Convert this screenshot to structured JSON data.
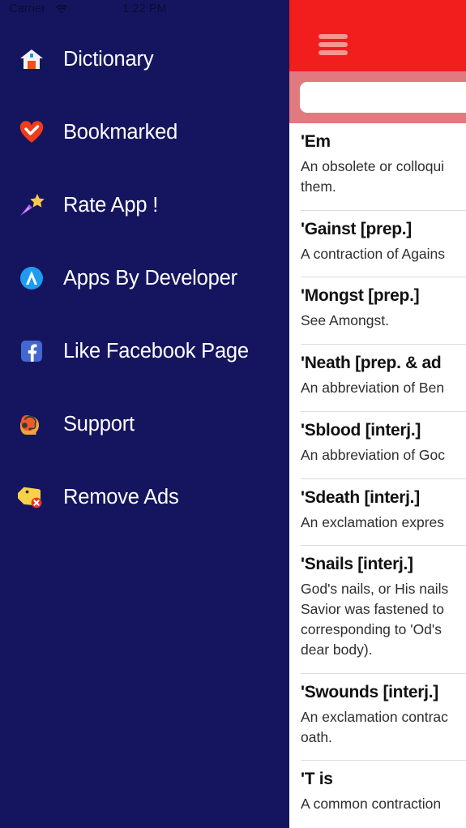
{
  "status_bar": {
    "carrier": "Carrier",
    "wifi_icon": "wifi-icon",
    "time": "1:22 PM",
    "battery_icon": "battery-full-icon"
  },
  "sidebar": {
    "background_color": "#15155F",
    "items": [
      {
        "label": "Dictionary",
        "icon": "house-icon"
      },
      {
        "label": "Bookmarked",
        "icon": "heart-check-icon"
      },
      {
        "label": "Rate App !",
        "icon": "shooting-star-icon"
      },
      {
        "label": "Apps By Developer",
        "icon": "app-store-icon"
      },
      {
        "label": "Like Facebook Page",
        "icon": "facebook-icon"
      },
      {
        "label": "Support",
        "icon": "headset-person-icon"
      },
      {
        "label": "Remove Ads",
        "icon": "tag-remove-icon"
      }
    ]
  },
  "panel": {
    "header_color": "#F21D1D",
    "searchbar_color": "#E07A7E",
    "menu_icon": "hamburger-menu-icon",
    "search": {
      "value": "",
      "placeholder": ""
    },
    "entries": [
      {
        "word": "'Em",
        "definition": "An obsolete or colloqui\nthem."
      },
      {
        "word": "'Gainst [prep.]",
        "definition": "A contraction of Agains"
      },
      {
        "word": "'Mongst [prep.]",
        "definition": "See Amongst."
      },
      {
        "word": "'Neath [prep. & ad",
        "definition": "An abbreviation of Ben"
      },
      {
        "word": "'Sblood [interj.]",
        "definition": "An abbreviation of Goc"
      },
      {
        "word": "'Sdeath [interj.]",
        "definition": "An exclamation expres"
      },
      {
        "word": "'Snails [interj.]",
        "definition": "God's nails, or His nails\nSavior was fastened to\ncorresponding to 'Od's\ndear body)."
      },
      {
        "word": "'Swounds [interj.]",
        "definition": "An exclamation contrac\noath."
      },
      {
        "word": "'T is",
        "definition": "A common contraction"
      }
    ]
  }
}
